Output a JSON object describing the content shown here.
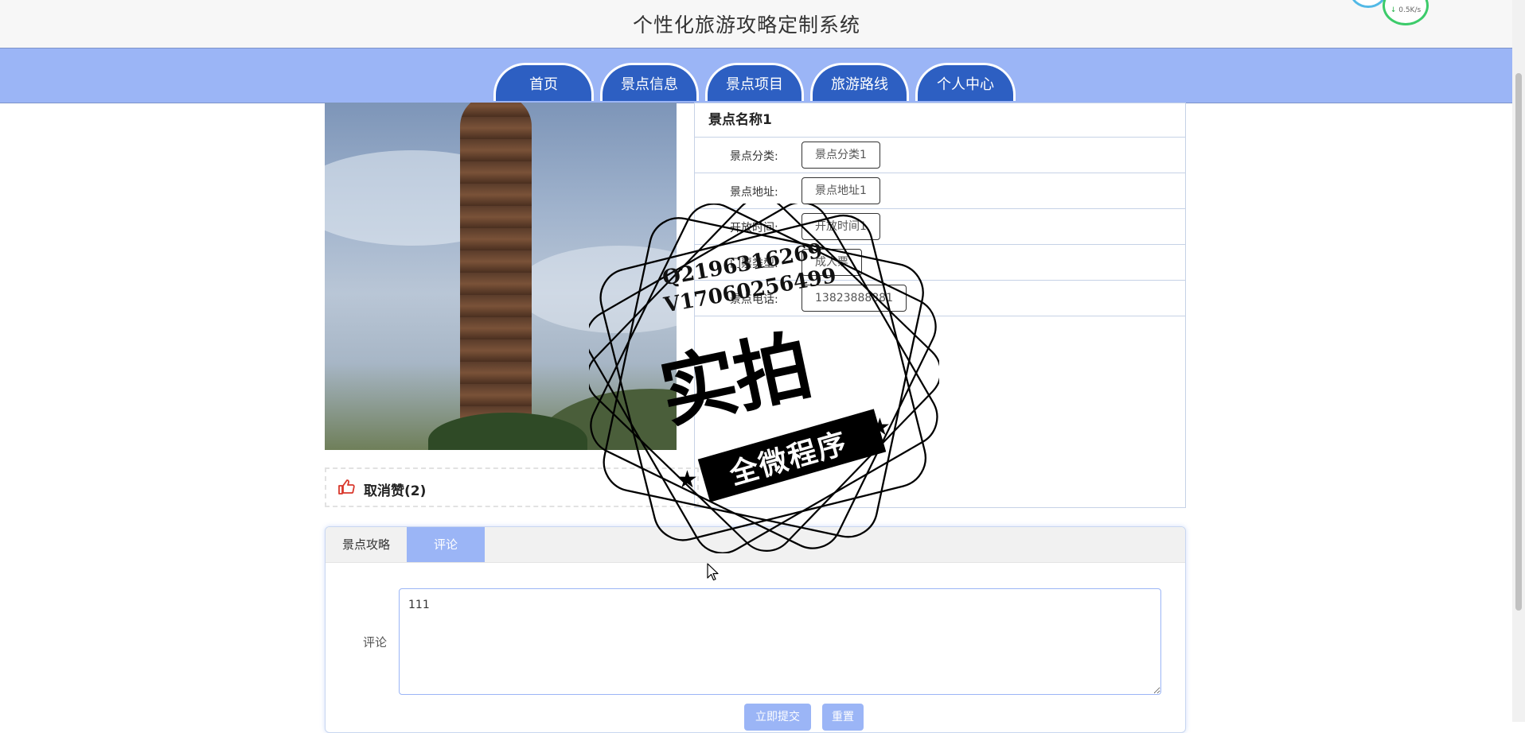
{
  "header": {
    "title": "个性化旅游攻略定制系统"
  },
  "net_widget": {
    "rate": "0.5K/s"
  },
  "nav": {
    "items": [
      {
        "label": "首页"
      },
      {
        "label": "景点信息"
      },
      {
        "label": "景点项目"
      },
      {
        "label": "旅游路线"
      },
      {
        "label": "个人中心"
      }
    ]
  },
  "detail": {
    "name": "景点名称1",
    "fields": [
      {
        "label": "景点分类:",
        "value": "景点分类1"
      },
      {
        "label": "景点地址:",
        "value": "景点地址1"
      },
      {
        "label": "开放时间:",
        "value": "开放时间1"
      },
      {
        "label": "门票类型:",
        "value": "成人票"
      },
      {
        "label": "景点电话:",
        "value": "13823888881"
      }
    ]
  },
  "like": {
    "label": "取消赞(2)"
  },
  "tabs": {
    "items": [
      {
        "label": "景点攻略"
      },
      {
        "label": "评论"
      }
    ],
    "active_index": 1
  },
  "comment_form": {
    "label": "评论",
    "value": "111",
    "submit_label": "立即提交",
    "reset_label": "重置"
  },
  "watermark": {
    "line1": "Q2196316269",
    "line2": "V17060256499",
    "big": "实拍",
    "ribbon": "全微程序"
  },
  "colors": {
    "nav_bg": "#9bb5f6",
    "nav_item": "#2d5fc2",
    "accent": "#9bb5f6"
  }
}
